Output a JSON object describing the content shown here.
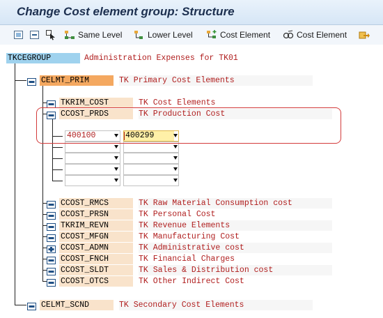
{
  "window": {
    "title": "Change Cost element group: Structure"
  },
  "toolbar": {
    "buttons": [
      {
        "icon": "expand-all-icon",
        "label": ""
      },
      {
        "icon": "collapse-all-icon",
        "label": ""
      },
      {
        "icon": "select-icon",
        "label": ""
      },
      {
        "icon": "same-level-icon",
        "label": "Same Level"
      },
      {
        "icon": "lower-level-icon",
        "label": "Lower Level"
      },
      {
        "icon": "create-cost-element-icon",
        "label": "Cost Element"
      },
      {
        "icon": "display-cost-element-icon",
        "label": "Cost Element"
      },
      {
        "icon": "exit-icon",
        "label": ""
      }
    ]
  },
  "root": {
    "code": "TKCEGROUP",
    "description": "Administration Expenses for TK01"
  },
  "groups": [
    {
      "code": "CELMT_PRIM",
      "description": "TK Primary Cost Elements",
      "children": [
        {
          "code": "TKRIM_COST",
          "description": "TK Cost Elements"
        },
        {
          "code": "CCOST_PRDS",
          "description": "TK Production Cost"
        },
        {
          "code": "CCOST_RMCS",
          "description": "TK Raw Material Consumption cost"
        },
        {
          "code": "CCOST_PRSN",
          "description": "TK Personal Cost"
        },
        {
          "code": "TKRIM_REVN",
          "description": "TK Revenue Elements"
        },
        {
          "code": "CCOST_MFGN",
          "description": "TK Manufacturing Cost"
        },
        {
          "code": "CCOST_ADMN",
          "description": "TK Administrative cost"
        },
        {
          "code": "CCOST_FNCH",
          "description": "TK Financial Charges"
        },
        {
          "code": "CCOST_SLDT",
          "description": "TK Sales & Distribution cost"
        },
        {
          "code": "CCOST_OTCS",
          "description": "TK Other Indirect Cost"
        }
      ]
    },
    {
      "code": "CELMT_SCND",
      "description": "TK Secondary Cost Elements"
    }
  ],
  "ranges": [
    {
      "from": "400100",
      "to": "400299"
    },
    {
      "from": "",
      "to": ""
    },
    {
      "from": "",
      "to": ""
    },
    {
      "from": "",
      "to": ""
    },
    {
      "from": "",
      "to": ""
    }
  ],
  "colors": {
    "root_highlight": "#9fd2ee",
    "group_highlight": "#f4a860",
    "child_code_bg": "#f9e3cb",
    "focused_input": "#fff0a8",
    "description_text": "#b01e1e",
    "annotation_box": "#d33a3a"
  }
}
